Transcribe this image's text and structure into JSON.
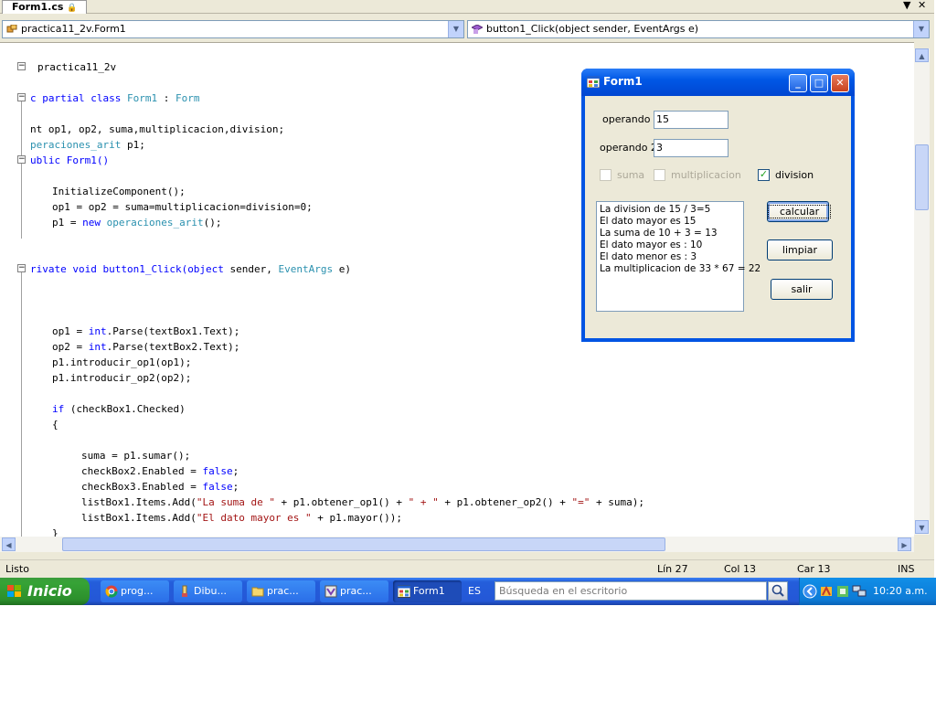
{
  "tab": {
    "title": "Form1.cs"
  },
  "nav": {
    "class_combo": "practica11_2v.Form1",
    "member_combo": "button1_Click(object sender, EventArgs e)"
  },
  "code_lines": {
    "l1": "practica11_2v",
    "l2a": "c partial class ",
    "l2b": "Form1",
    "l2c": " : ",
    "l2d": "Form",
    "l3": "nt op1, op2, suma,multiplicacion,division;",
    "l4a": "peraciones_arit",
    "l4b": " p1;",
    "l5": "ublic Form1()",
    "l6": "InitializeComponent();",
    "l7": "op1 = op2 = suma=multiplicacion=division=0;",
    "l8a": "p1 = ",
    "l8b": "new",
    "l8c": " ",
    "l8d": "operaciones_arit",
    "l8e": "();",
    "l9a": "rivate void button1_Click(",
    "l9b": "object",
    "l9c": " sender, ",
    "l9d": "EventArgs",
    "l9e": " e)",
    "l10a": "op1 = ",
    "l10b": "int",
    "l10c": ".Parse(textBox1.Text);",
    "l11a": "op2 = ",
    "l11b": "int",
    "l11c": ".Parse(textBox2.Text);",
    "l12": "p1.introducir_op1(op1);",
    "l13": "p1.introducir_op2(op2);",
    "l14a": "if",
    "l14b": " (checkBox1.Checked)",
    "l15": "{",
    "l16": "suma = p1.sumar();",
    "l17a": "checkBox2.Enabled = ",
    "l17b": "false",
    "l17c": ";",
    "l18a": "checkBox3.Enabled = ",
    "l18b": "false",
    "l18c": ";",
    "l19a": "listBox1.Items.Add(",
    "l19b": "\"La suma de \"",
    "l19c": " + p1.obtener_op1() + ",
    "l19d": "\" + \"",
    "l19e": " + p1.obtener_op2() + ",
    "l19f": "\"=\"",
    "l19g": " + suma);",
    "l20a": "listBox1.Items.Add(",
    "l20b": "\"El dato mayor es \"",
    "l20c": " + p1.mayor());",
    "l21": "}"
  },
  "status": {
    "left": "Listo",
    "line": "Lín 27",
    "col": "Col 13",
    "car": "Car 13",
    "mode": "INS"
  },
  "form1": {
    "title": "Form1",
    "label1": "operando 1",
    "value1": "15",
    "label2": "operando 2",
    "value2": "3",
    "check_suma": "suma",
    "check_mult": "multiplicacion",
    "check_div": "division",
    "list_items": [
      "La division de 15 / 3=5",
      "El dato mayor es 15",
      "La suma de 10 + 3 = 13",
      "El dato mayor es : 10",
      "El dato menor es : 3",
      "La multiplicacion de 33 * 67 = 22"
    ],
    "btn_calcular": "calcular",
    "btn_limpiar": "limpiar",
    "btn_salir": "salir"
  },
  "taskbar": {
    "start": "Inicio",
    "tasks": [
      "prog...",
      "Dibu...",
      "prac...",
      "prac...",
      "Form1"
    ],
    "lang": "ES",
    "search_placeholder": "Búsqueda en el escritorio",
    "clock": "10:20 a.m."
  },
  "colors": {
    "keyword": "#0000ff",
    "type": "#2b91af",
    "string": "#a31515",
    "xp_blue": "#0054e3",
    "start_green": "#36a336"
  }
}
